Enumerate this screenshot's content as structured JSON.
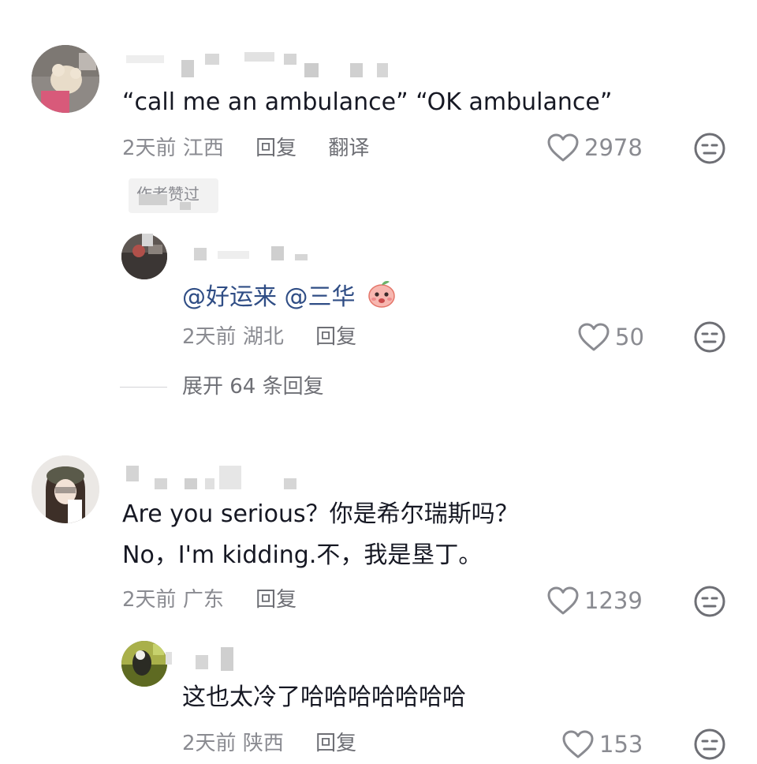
{
  "comments": [
    {
      "text": "“call me an ambulance” “OK ambulance”",
      "time": "2天前",
      "location": "江西",
      "reply_label": "回复",
      "translate_label": "翻译",
      "likes": "2978",
      "author_liked_badge": "作者赞过",
      "replies": [
        {
          "mention1": "@好运来",
          "mention2": "@三华",
          "time": "2天前",
          "location": "湖北",
          "reply_label": "回复",
          "likes": "50"
        }
      ],
      "expand_label": "展开 64 条回复"
    },
    {
      "text_line1": "Are you serious？你是希尔瑞斯吗？",
      "text_line2": "No，I'm kidding.不，我是垦丁。",
      "time": "2天前",
      "location": "广东",
      "reply_label": "回复",
      "likes": "1239",
      "replies": [
        {
          "text": "这也太冷了哈哈哈哈哈哈哈",
          "time": "2天前",
          "location": "陕西",
          "reply_label": "回复",
          "likes": "153"
        }
      ]
    }
  ],
  "colors": {
    "text": "#161823",
    "meta": "#8a8b91",
    "mention": "#2f4d85",
    "background": "#ffffff"
  },
  "icons": [
    "heart-icon",
    "dislike-face-icon",
    "peach-emoji-icon"
  ]
}
